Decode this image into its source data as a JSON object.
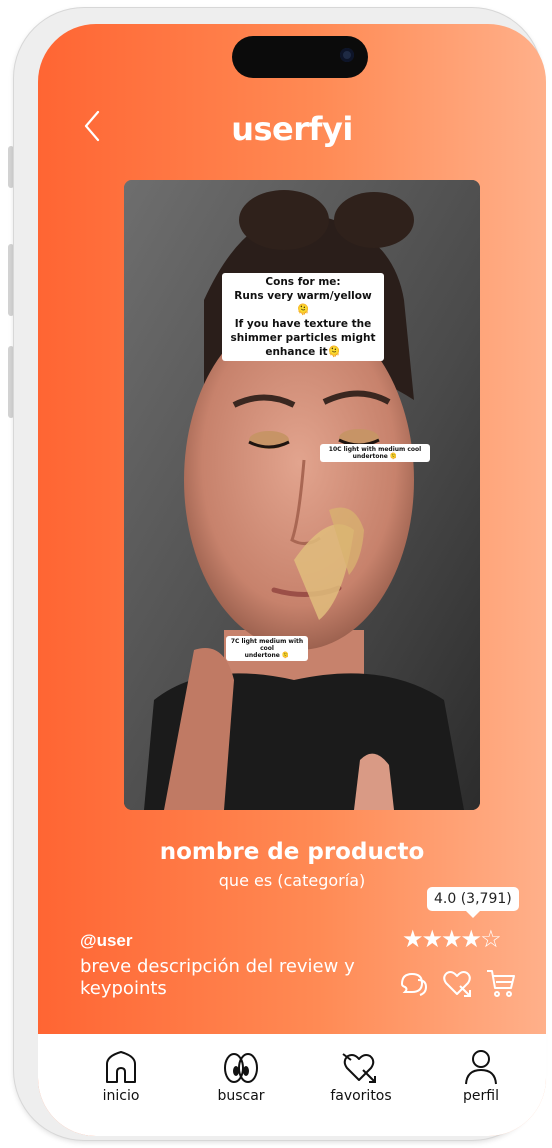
{
  "app": {
    "logo": "userfyi"
  },
  "video": {
    "captions": {
      "main": "Cons for me:\nRuns very warm/yellow 🫠\nIf you have texture the\nshimmer particles might\nenhance it🫠",
      "shade_10c": "10C light with medium cool\nundertone 🫠",
      "shade_7c": "7C light medium with cool\nundertone 🫠"
    }
  },
  "product": {
    "name": "nombre de producto",
    "category": "que es (categoría)",
    "rating_label": "4.0 (3,791)",
    "rating_value": 4.0,
    "rating_max": 5,
    "stars_text": "★★★★☆"
  },
  "review": {
    "user": "@user",
    "description": "breve descripción del review y keypoints"
  },
  "actions": [
    "comment-icon",
    "favorite-icon",
    "cart-icon"
  ],
  "tabs": [
    {
      "label": "inicio",
      "icon": "home-icon"
    },
    {
      "label": "buscar",
      "icon": "eyes-icon"
    },
    {
      "label": "favoritos",
      "icon": "heart-arrow-icon"
    },
    {
      "label": "perfil",
      "icon": "person-icon"
    }
  ],
  "colors": {
    "gradient_start": "#ff6533",
    "gradient_end": "#ffb08a",
    "text": "#ffffff"
  }
}
